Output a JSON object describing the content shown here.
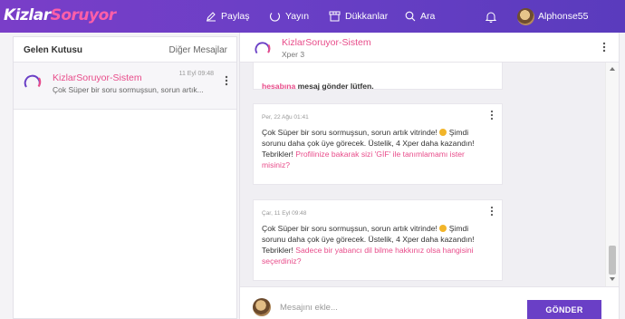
{
  "brand": {
    "part1": "Kizlar",
    "part2": "Soruyor"
  },
  "nav": {
    "paylas": "Paylaş",
    "yayin": "Yayın",
    "dukkanlar": "Dükkanlar",
    "ara": "Ara",
    "username": "Alphonse55"
  },
  "inbox": {
    "title": "Gelen Kutusu",
    "other": "Diğer Mesajlar",
    "conversations": [
      {
        "name": "KizlarSoruyor-Sistem",
        "time": "11 Eyl 09:48",
        "preview": "Çok Süper bir soru sormuşsun, sorun artık..."
      }
    ]
  },
  "chat": {
    "name": "KizlarSoruyor-Sistem",
    "level": "Xper 3",
    "messages": [
      {
        "date": "",
        "text": "",
        "partial_link": "hesabına",
        "partial_rest": " mesaj gönder lütfen."
      },
      {
        "date": "Per, 22 Ağu 01:41",
        "text": "Çok Süper bir soru sormuşsun, sorun artık vitrinde!",
        "text2": " Şimdi sorunu daha çok üye görecek. Üstelik, 4 Xper daha kazandın! Tebrikler! ",
        "link": "Profilinize bakarak sizi 'GİF' ile tanımlamamı ister misiniz?"
      },
      {
        "date": "Çar, 11 Eyl 09:48",
        "text": "Çok Süper bir soru sormuşsun, sorun artık vitrinde!",
        "text2": " Şimdi sorunu daha çok üye görecek. Üstelik, 4 Xper daha kazandın! Tebrikler! ",
        "link": "Sadece bir yabancı dil bilme hakkınız olsa hangisini seçerdiniz?"
      }
    ],
    "compose_placeholder": "Mesajını ekle...",
    "send_label": "GÖNDER"
  },
  "colors": {
    "brand": "#6a3fc6",
    "accent": "#e84c8a"
  }
}
